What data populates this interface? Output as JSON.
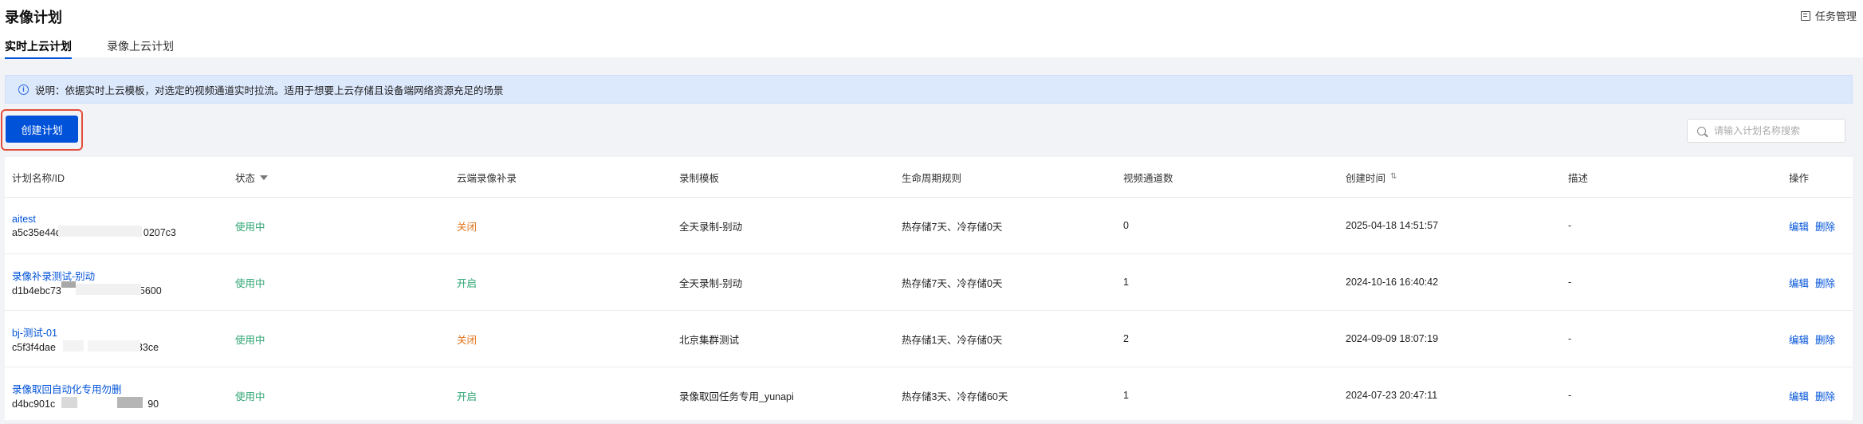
{
  "header": {
    "title": "录像计划",
    "task_mgmt": "任务管理"
  },
  "tabs": [
    {
      "label": "实时上云计划",
      "active": true
    },
    {
      "label": "录像上云计划",
      "active": false
    }
  ],
  "notice": {
    "text": "说明：依据实时上云模板，对选定的视频通道实时拉流。适用于想要上云存储且设备端网络资源充足的场景"
  },
  "toolbar": {
    "create_label": "创建计划",
    "search_placeholder": "请输入计划名称搜索"
  },
  "table": {
    "columns": [
      "计划名称/ID",
      "状态",
      "云端录像补录",
      "录制模板",
      "生命周期规则",
      "视频通道数",
      "创建时间",
      "描述",
      "操作"
    ],
    "rows": [
      {
        "name": "aitest",
        "id_start": "a5c35e44d",
        "id_end": "0207c3",
        "status": "使用中",
        "backfill": "关闭",
        "template": "全天录制-别动",
        "lifecycle": "热存储7天、冷存储0天",
        "channels": "0",
        "created": "2025-04-18 14:51:57",
        "desc": "-"
      },
      {
        "name": "录像补录测试-别动",
        "id_start": "d1b4ebc73",
        "id_end": "5600",
        "status": "使用中",
        "backfill": "开启",
        "template": "全天录制-别动",
        "lifecycle": "热存储7天、冷存储0天",
        "channels": "1",
        "created": "2024-10-16 16:40:42",
        "desc": "-"
      },
      {
        "name": "bj-测试-01",
        "id_start": "c5f3f4dae",
        "id_end": "83ce",
        "status": "使用中",
        "backfill": "关闭",
        "template": "北京集群测试",
        "lifecycle": "热存储1天、冷存储0天",
        "channels": "2",
        "created": "2024-09-09 18:07:19",
        "desc": "-"
      },
      {
        "name": "录像取回自动化专用勿删",
        "id_start": "d4bc901c",
        "id_end": "90",
        "status": "使用中",
        "backfill": "开启",
        "template": "录像取回任务专用_yunapi",
        "lifecycle": "热存储3天、冷存储60天",
        "channels": "1",
        "created": "2024-07-23 20:47:11",
        "desc": "-"
      }
    ],
    "op_edit": "编辑",
    "op_delete": "删除"
  },
  "colors": {
    "accent": "#0052d9",
    "status_ok": "#2ba471",
    "status_off": "#e37318",
    "highlight_box": "#e34d3b"
  }
}
